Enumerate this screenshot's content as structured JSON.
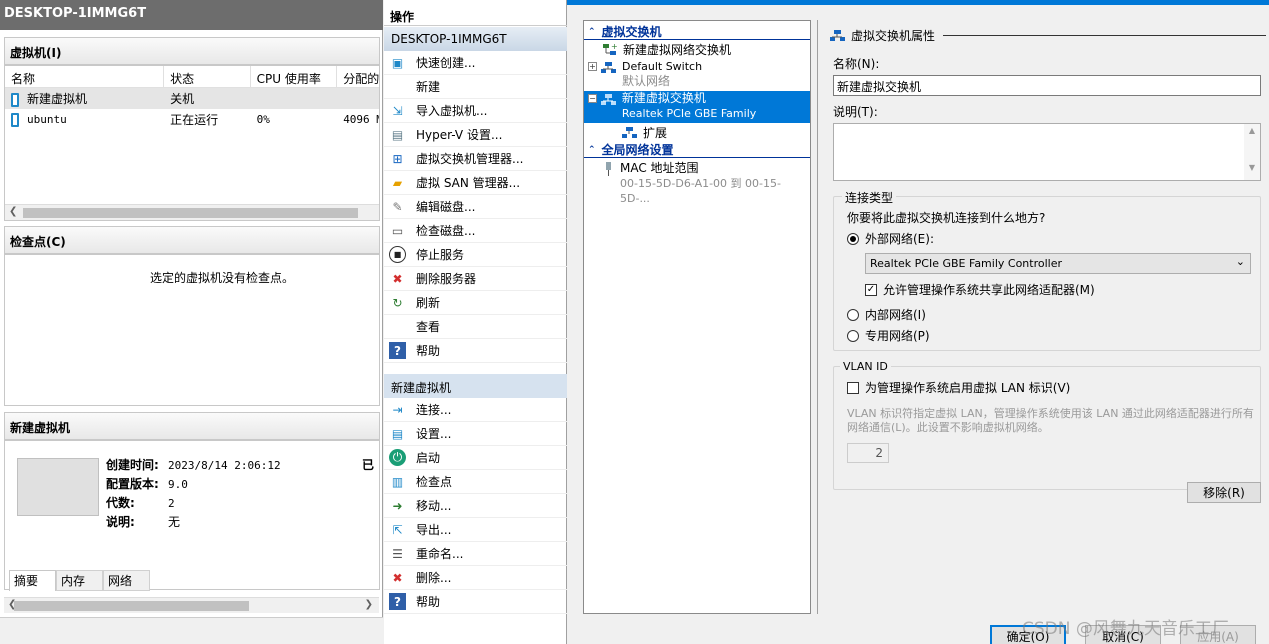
{
  "left": {
    "title": "DESKTOP-1IMMG6T",
    "vms_header": "虚拟机(I)",
    "vm_columns": [
      "名称",
      "状态",
      "CPU 使用率",
      "分配的"
    ],
    "vms": [
      {
        "name": "新建虚拟机",
        "state": "关机",
        "cpu": "",
        "mem": ""
      },
      {
        "name": "ubuntu",
        "state": "正在运行",
        "cpu": "0%",
        "mem": "4096 M"
      }
    ],
    "checkpoints_header": "检查点(C)",
    "checkpoints_empty": "选定的虚拟机没有检查点。",
    "details_header": "新建虚拟机",
    "details": [
      {
        "label": "创建时间:",
        "value": "2023/8/14 2:06:12"
      },
      {
        "label": "配置版本:",
        "value": "9.0"
      },
      {
        "label": "代数:",
        "value": "2"
      },
      {
        "label": "说明:",
        "value": "无"
      }
    ],
    "details_cut": "已",
    "detail_tabs": [
      "摘要",
      "内存",
      "网络"
    ]
  },
  "actions": {
    "title": "操作",
    "host_header": "DESKTOP-1IMMG6T",
    "host_items": [
      {
        "label": "快速创建...",
        "icon": "quick-create-icon"
      },
      {
        "label": "新建",
        "icon": "new-icon"
      },
      {
        "label": "导入虚拟机...",
        "icon": "import-vm-icon"
      },
      {
        "label": "Hyper-V 设置...",
        "icon": "hyperv-settings-icon"
      },
      {
        "label": "虚拟交换机管理器...",
        "icon": "switch-manager-icon"
      },
      {
        "label": "虚拟 SAN 管理器...",
        "icon": "san-manager-icon"
      },
      {
        "label": "编辑磁盘...",
        "icon": "edit-disk-icon"
      },
      {
        "label": "检查磁盘...",
        "icon": "inspect-disk-icon"
      },
      {
        "label": "停止服务",
        "icon": "stop-service-icon"
      },
      {
        "label": "删除服务器",
        "icon": "remove-server-icon"
      },
      {
        "label": "刷新",
        "icon": "refresh-icon"
      },
      {
        "label": "查看",
        "icon": "view-icon"
      },
      {
        "label": "帮助",
        "icon": "help-icon"
      }
    ],
    "vm_header": "新建虚拟机",
    "vm_items": [
      {
        "label": "连接...",
        "icon": "connect-icon"
      },
      {
        "label": "设置...",
        "icon": "settings-icon"
      },
      {
        "label": "启动",
        "icon": "start-icon"
      },
      {
        "label": "检查点",
        "icon": "checkpoint-icon"
      },
      {
        "label": "移动...",
        "icon": "move-icon"
      },
      {
        "label": "导出...",
        "icon": "export-icon"
      },
      {
        "label": "重命名...",
        "icon": "rename-icon"
      },
      {
        "label": "删除...",
        "icon": "delete-icon"
      },
      {
        "label": "帮助",
        "icon": "help-icon"
      }
    ]
  },
  "tree": {
    "switches_header": "虚拟交换机",
    "new_switch": "新建虚拟网络交换机",
    "default_switch": "Default Switch",
    "default_sub": "默认网络",
    "selected_switch": "新建虚拟交换机",
    "selected_sub": "Realtek PCIe GBE Family Controller",
    "extensions": "扩展",
    "global_header": "全局网络设置",
    "mac_range": "MAC 地址范围",
    "mac_value": "00-15-5D-D6-A1-00 到 00-15-5D-..."
  },
  "props": {
    "section_title": "虚拟交换机属性",
    "name_label": "名称(N):",
    "name_value": "新建虚拟交换机",
    "desc_label": "说明(T):",
    "conn_group": "连接类型",
    "conn_question": "你要将此虚拟交换机连接到什么地方?",
    "external_label": "外部网络(E):",
    "adapter_value": "Realtek PCIe GBE Family Controller",
    "allow_share": "允许管理操作系统共享此网络适配器(M)",
    "internal_label": "内部网络(I)",
    "private_label": "专用网络(P)",
    "vlan_group": "VLAN ID",
    "vlan_enable": "为管理操作系统启用虚拟 LAN 标识(V)",
    "vlan_desc": "VLAN 标识符指定虚拟 LAN，管理操作系统使用该 LAN 通过此网络适配器进行所有网络通信(L)。此设置不影响虚拟机网络。",
    "vlan_value": "2",
    "remove_button": "移除(R)",
    "ok_button": "确定(O)",
    "cancel_button": "取消(C)",
    "apply_button": "应用(A)"
  },
  "watermark": "CSDN @风舞九天音乐工厂"
}
